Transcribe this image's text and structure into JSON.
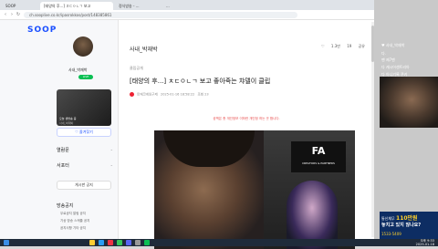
{
  "browser": {
    "tabs": [
      {
        "label": "SOOP"
      },
      {
        "label": "[태양의 후...] ㅊㄷㅇㄴㄱ 보고"
      },
      {
        "label": "정식방송 - ..."
      },
      {
        "label": "..."
      }
    ],
    "url": "ch.sooplive.co.kr/ipasrokkos/post/148385861"
  },
  "sidebar": {
    "logo": "SOOP",
    "station_name": "사내_박재박",
    "live_badge": "LIVE",
    "live_caption": "오늘 생방송 중",
    "live_sub": "사내_박재박",
    "follow_label": "♡ 즐겨찾기",
    "menu": [
      {
        "label": "열람문"
      },
      {
        "label": "서포터"
      }
    ],
    "notice_button": "게시판 공지",
    "broadcast_title": "방송공지",
    "broadcast_items": [
      {
        "label": "무료공지 알림 공지"
      },
      {
        "label": "기상 방송 스케줄 공지"
      },
      {
        "label": "공지사항 기타 공지"
      }
    ]
  },
  "main": {
    "breadcrumb": "사내_박재박",
    "header_actions": {
      "share": "공유",
      "count": "1.3만",
      "likes": "19"
    },
    "category": "클립공개",
    "post_title": "[태양의 후...] ㅊㄷㅇㄴㄱ 보고 좋아죽는 챠델이 클립",
    "meta": {
      "author": "만재코게임구제",
      "date": "2025-01-16 18:58:22",
      "views": "조회 23"
    },
    "notice": "공백은 총 개인정보 이하란 개인정 하는 곳 합니다.",
    "video_logo": "FA",
    "video_logo_sub": "CREATORS & PARTNERS"
  },
  "right_panel": {
    "chat": [
      {
        "name": "",
        "text": "♥ 사내_박재박"
      },
      {
        "name": "",
        "text": "다."
      },
      {
        "name": "",
        "text": "팬 제7팬"
      },
      {
        "name": "",
        "text": "다 캐시어센트리아 "
      },
      {
        "name": "",
        "text": "다 아니기록 쿠키"
      }
    ],
    "ad": {
      "line1": "통신채무",
      "amount": "110만원",
      "line2": "놓치고 있지 않나요?",
      "phone": "1533-5409"
    }
  },
  "taskbar": {
    "time": "오후 9:33",
    "date": "2025-01-18"
  }
}
